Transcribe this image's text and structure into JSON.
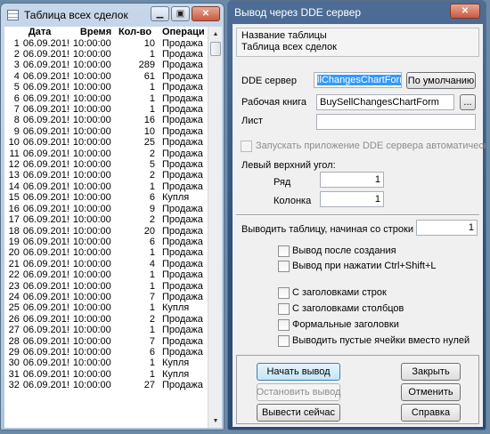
{
  "deals_window": {
    "title": "Таблица всех сделок",
    "columns": [
      "",
      "Дата",
      "Время",
      "Кол-во",
      "Операци"
    ],
    "rows": [
      [
        "1",
        "06.09.201!",
        "10:00:00",
        "10",
        "Продажа"
      ],
      [
        "2",
        "06.09.201!",
        "10:00:00",
        "1",
        "Продажа"
      ],
      [
        "3",
        "06.09.201!",
        "10:00:00",
        "289",
        "Продажа"
      ],
      [
        "4",
        "06.09.201!",
        "10:00:00",
        "61",
        "Продажа"
      ],
      [
        "5",
        "06.09.201!",
        "10:00:00",
        "1",
        "Продажа"
      ],
      [
        "6",
        "06.09.201!",
        "10:00:00",
        "1",
        "Продажа"
      ],
      [
        "7",
        "06.09.201!",
        "10:00:00",
        "1",
        "Продажа"
      ],
      [
        "8",
        "06.09.201!",
        "10:00:00",
        "16",
        "Продажа"
      ],
      [
        "9",
        "06.09.201!",
        "10:00:00",
        "10",
        "Продажа"
      ],
      [
        "10",
        "06.09.201!",
        "10:00:00",
        "25",
        "Продажа"
      ],
      [
        "11",
        "06.09.201!",
        "10:00:00",
        "2",
        "Продажа"
      ],
      [
        "12",
        "06.09.201!",
        "10:00:00",
        "5",
        "Продажа"
      ],
      [
        "13",
        "06.09.201!",
        "10:00:00",
        "2",
        "Продажа"
      ],
      [
        "14",
        "06.09.201!",
        "10:00:00",
        "1",
        "Продажа"
      ],
      [
        "15",
        "06.09.201!",
        "10:00:00",
        "6",
        "Купля"
      ],
      [
        "16",
        "06.09.201!",
        "10:00:00",
        "9",
        "Продажа"
      ],
      [
        "17",
        "06.09.201!",
        "10:00:00",
        "2",
        "Продажа"
      ],
      [
        "18",
        "06.09.201!",
        "10:00:00",
        "20",
        "Продажа"
      ],
      [
        "19",
        "06.09.201!",
        "10:00:00",
        "6",
        "Продажа"
      ],
      [
        "20",
        "06.09.201!",
        "10:00:00",
        "1",
        "Продажа"
      ],
      [
        "21",
        "06.09.201!",
        "10:00:00",
        "4",
        "Продажа"
      ],
      [
        "22",
        "06.09.201!",
        "10:00:00",
        "1",
        "Продажа"
      ],
      [
        "23",
        "06.09.201!",
        "10:00:00",
        "1",
        "Продажа"
      ],
      [
        "24",
        "06.09.201!",
        "10:00:00",
        "7",
        "Продажа"
      ],
      [
        "25",
        "06.09.201!",
        "10:00:00",
        "1",
        "Купля"
      ],
      [
        "26",
        "06.09.201!",
        "10:00:00",
        "2",
        "Продажа"
      ],
      [
        "27",
        "06.09.201!",
        "10:00:00",
        "1",
        "Продажа"
      ],
      [
        "28",
        "06.09.201!",
        "10:00:00",
        "7",
        "Продажа"
      ],
      [
        "29",
        "06.09.201!",
        "10:00:00",
        "6",
        "Продажа"
      ],
      [
        "30",
        "06.09.201!",
        "10:00:00",
        "1",
        "Купля"
      ],
      [
        "31",
        "06.09.201!",
        "10:00:00",
        "1",
        "Купля"
      ],
      [
        "32",
        "06.09.201!",
        "10:00:00",
        "27",
        "Продажа"
      ]
    ]
  },
  "dde_window": {
    "title": "Вывод через DDE сервер",
    "table_name_label": "Название таблицы",
    "table_name_value": "Таблица всех сделок",
    "dde_server_label": "DDE сервер",
    "dde_server_value": "llChangesChartForm",
    "default_button": "По умолчанию",
    "workbook_label": "Рабочая книга",
    "workbook_value": "BuySellChangesChartForm",
    "browse_button": "...",
    "sheet_label": "Лист",
    "sheet_value": "",
    "autostart_label": "Запускать приложение DDE сервера автоматически",
    "top_left_label": "Левый верхний угол:",
    "row_label": "Ряд",
    "row_value": "1",
    "column_label": "Колонка",
    "column_value": "1",
    "start_row_label": "Выводить таблицу,  начиная со строки",
    "start_row_value": "1",
    "checkboxes": [
      "Вывод после создания",
      "Вывод при нажатии Ctrl+Shift+L",
      "С заголовками строк",
      "С заголовками столбцов",
      "Формальные заголовки",
      "Выводить пустые ячейки вместо нулей"
    ],
    "buttons": {
      "start": "Начать вывод",
      "close": "Закрыть",
      "stop": "Остановить вывод",
      "cancel": "Отменить",
      "output_now": "Вывести сейчас",
      "help": "Справка"
    }
  }
}
